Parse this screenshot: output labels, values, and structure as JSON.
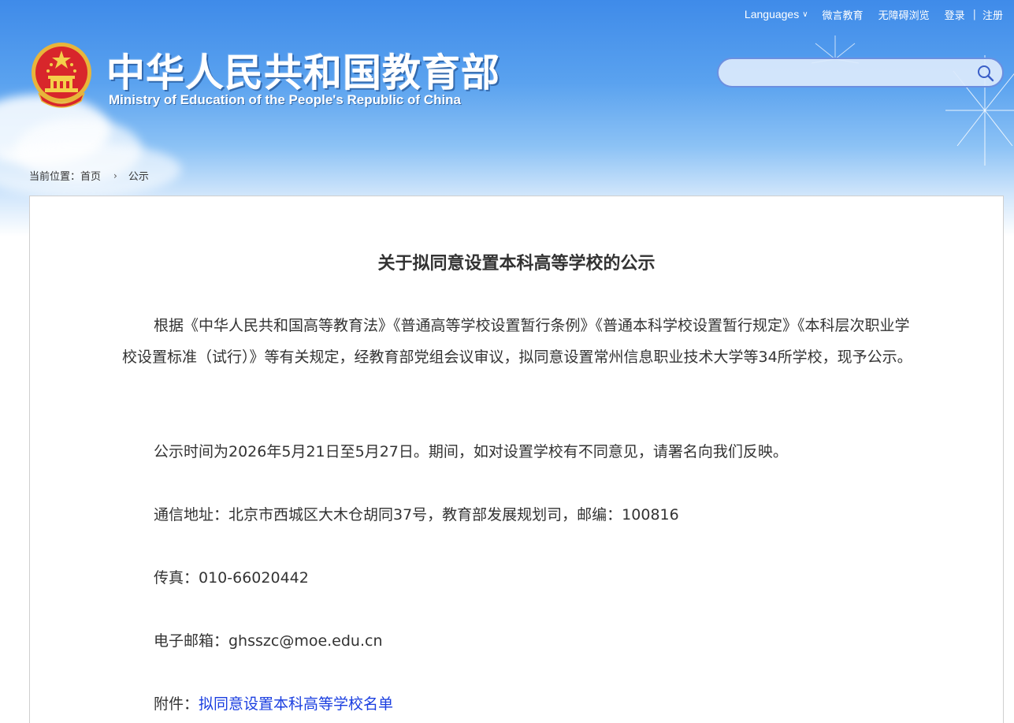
{
  "topbar": {
    "languages": "Languages",
    "weiyan": "微言教育",
    "accessible": "无障碍浏览",
    "login": "登录",
    "separator": "|",
    "register": "注册"
  },
  "site": {
    "title": "中华人民共和国教育部",
    "subtitle": "Ministry of Education of the People's Republic of China"
  },
  "search": {
    "placeholder": ""
  },
  "breadcrumb": {
    "prefix": "当前位置：",
    "home": "首页",
    "current": "公示"
  },
  "article": {
    "title": "关于拟同意设置本科高等学校的公示",
    "p1": "根据《中华人民共和国高等教育法》《普通高等学校设置暂行条例》《普通本科学校设置暂行规定》《本科层次职业学校设置标准（试行）》等有关规定，经教育部党组会议审议，拟同意设置常州信息职业技术大学等34所学校，现予公示。",
    "p2": "公示时间为2026年5月21日至5月27日。期间，如对设置学校有不同意见，请署名向我们反映。",
    "p3": "通信地址：北京市西城区大木仓胡同37号，教育部发展规划司，邮编：100816",
    "p4": "传真：010-66020442",
    "p5": "电子邮箱：ghsszc@moe.edu.cn",
    "attachment_label": "附件：",
    "attachment_link": "拟同意设置本科高等学校名单"
  },
  "colors": {
    "header_blue": "#3f8be9",
    "text": "#333333",
    "link": "#1a3ee0"
  }
}
